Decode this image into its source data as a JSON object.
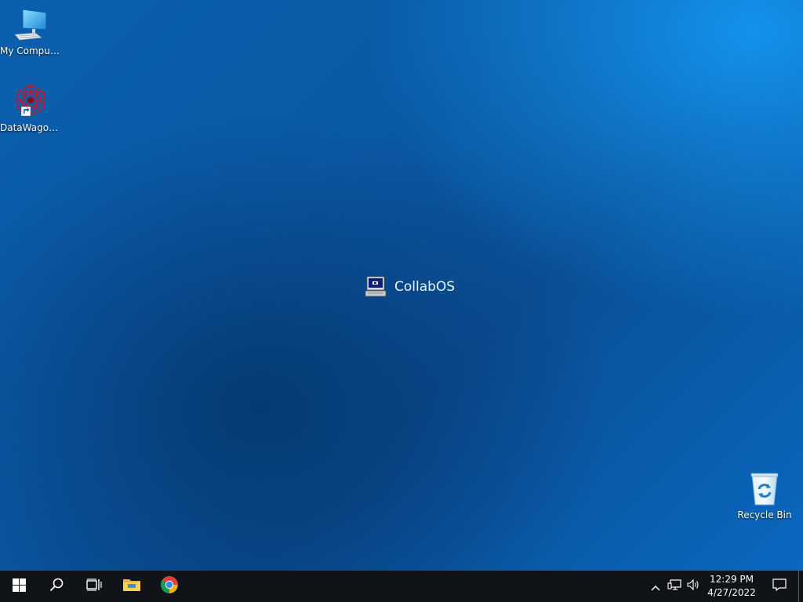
{
  "desktop": {
    "icons": {
      "my_computer": {
        "label": "My Computer",
        "icon": "computer-icon"
      },
      "datawagon": {
        "label": "DataWagon...",
        "icon": "datawagon-shortcut-icon"
      },
      "recycle_bin": {
        "label": "Recycle Bin",
        "icon": "recycle-bin-icon"
      }
    },
    "center_logo": {
      "label": "CollabOS",
      "icon": "retro-computer-icon"
    }
  },
  "taskbar": {
    "buttons": [
      "start-icon",
      "search-icon",
      "task-view-icon",
      "file-explorer-icon",
      "chrome-icon"
    ],
    "tray": {
      "icons": [
        "chevron-up-icon",
        "network-icon",
        "volume-icon"
      ],
      "time": "12:29 PM",
      "date": "4/27/2022",
      "notification_icon": "notification-icon"
    }
  },
  "colors": {
    "taskbar": "#101418",
    "desktop_dark": "#0a4f95",
    "desktop_light": "#1496f0"
  }
}
